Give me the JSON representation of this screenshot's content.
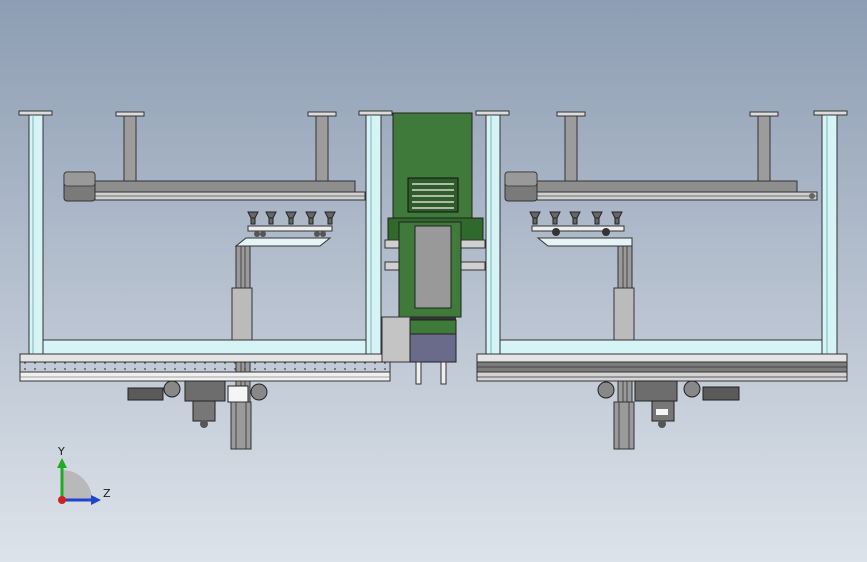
{
  "viewport": {
    "background_top": "#8d9db3",
    "background_bottom": "#dde3ea"
  },
  "colors": {
    "frame_cyan": "#d6f4f6",
    "outline": "#2b2b2b",
    "post_gray": "#9c9c9c",
    "beam_gray": "#8e8e8e",
    "module_green": "#3f7a3a",
    "motor_purple": "#6a6a8a",
    "rail_white": "#eeeeee"
  },
  "triad": {
    "y_label": "Y",
    "z_label": "Z",
    "y_color": "#22aa22",
    "z_color": "#2244cc",
    "origin_color": "#cc2222"
  }
}
